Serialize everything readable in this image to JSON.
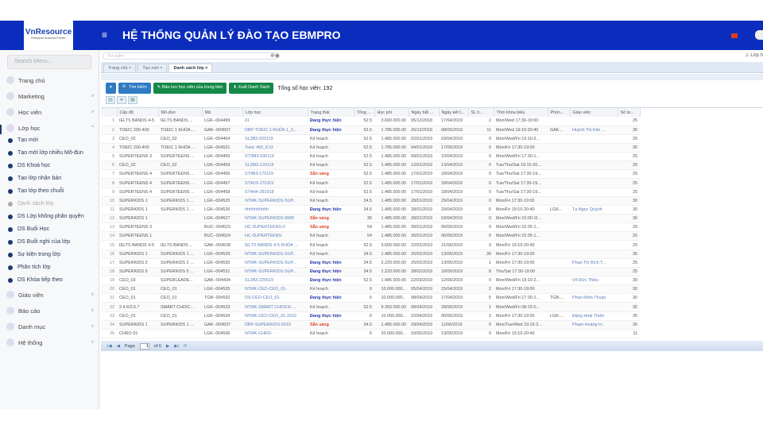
{
  "header": {
    "logo": "VnResource",
    "logo_tag": "Enterprise Business Partner",
    "title": "HỆ THỐNG QUẢN LÝ ĐÀO TẠO EBMPRO"
  },
  "sidebar": {
    "search_placeholder": "Search Menu...",
    "items": [
      {
        "label": "Trang chủ"
      },
      {
        "label": "Marketing"
      },
      {
        "label": "Học viên"
      },
      {
        "label": "Lớp học"
      }
    ],
    "sub": [
      "Tạo mới",
      "Tạo mới lớp nhiều Mô-đun",
      "DS Khoá học",
      "Tạo lớp nhân bản",
      "Tạo lớp theo chuỗi",
      "Danh sách lớp",
      "DS Lớp không phân quyền",
      "DS Buổi Học",
      "DS Buổi nghỉ của lớp",
      "Sự kiện trong lớp",
      "Phân tích lớp",
      "DS Khóa tiếp theo"
    ],
    "items2": [
      {
        "label": "Giáo viên"
      },
      {
        "label": "Báo cáo"
      },
      {
        "label": "Danh mục"
      },
      {
        "label": "Hệ thống"
      }
    ]
  },
  "search": {
    "placeholder": "Tìm kiếm"
  },
  "right_link": "Lớp h",
  "tabs": [
    "Trang chủ",
    "Tạo mới",
    "Danh sách lớp"
  ],
  "toolbar": {
    "search": "Tìm kiếm",
    "save": "Bảo lưu học viên của trung tâm",
    "export": "Xuất Danh Sách",
    "total": "Tổng số học viên: 192"
  },
  "colors": {
    "header": "#0b2dbd",
    "running": "#2a3aa8",
    "ready": "#e0452a",
    "plan": "#555555"
  },
  "columns": [
    "",
    "Cấp độ",
    "Mô-đun",
    "Mã",
    "Lớp học",
    "Trạng thái",
    "Tổng ...",
    "Học phí",
    "Ngày bắt ...",
    "Ngày kết t...",
    "SL h...",
    "Thời khóa biểu",
    "Phòn...",
    "Giáo viên",
    "Số lư..."
  ],
  "rows": [
    [
      "1",
      "IELTS BANDS 4-5",
      "IELTS BANDS ...",
      "LGK--004499",
      "01",
      "Đang thực hiện",
      "52.5",
      "3.600.000.00",
      "05/12/2018",
      "17/04/2019",
      "2",
      "Mon/Wed 17:30-19:00",
      "",
      "",
      "25"
    ],
    [
      "2",
      "TOEIC 200-400",
      "TOEIC 1 KHÓA ...",
      "GAK--004507",
      "DBP-TOEIC 1 KHÓA 1_3...",
      "Đang thực hiện",
      "52.5",
      "1.785.000.00",
      "26/12/2018",
      "08/05/2019",
      "11",
      "Mon/Wed 19:10-20:40",
      "GAK...",
      "Huỳnh Thị Kim ...",
      "30"
    ],
    [
      "3",
      "CEO_02",
      "CEO_02",
      "LGK--004454",
      "SL3B3-020119",
      "Kế hoạch",
      "52.5",
      "1.485.000.00",
      "02/01/2019",
      "03/04/2019",
      "0",
      "Mon/Wed/Fri 19:10-2...",
      "",
      "",
      "25"
    ],
    [
      "4",
      "TOEIC 200-400",
      "TOEIC 1 KHÓA ...",
      "LGK--004521",
      "Toeic 400_K13",
      "Kế hoạch",
      "52.5",
      "1.785.000.00",
      "04/01/2019",
      "17/05/2019",
      "0",
      "Mon/Fri 17:30-19:00",
      "",
      "",
      "30"
    ],
    [
      "5",
      "SUPERTEENS 3",
      "SUPERTEENS ...",
      "LGK--004455",
      "ST3M3-090119",
      "Kế hoạch",
      "52.5",
      "1.485.000.00",
      "09/01/2019",
      "10/04/2019",
      "0",
      "Mon/Wed/Fri 17:30-1...",
      "",
      "",
      "25"
    ],
    [
      "6",
      "CEO_02",
      "CEO_02",
      "LGK--004459",
      "SL3M3-120119",
      "Kế hoạch",
      "52.5",
      "1.485.000.00",
      "12/01/2019",
      "13/04/2019",
      "0",
      "Tue/Thu/Sat 19:10-20...",
      "",
      "",
      "25"
    ],
    [
      "7",
      "SUPERTEENS 4",
      "SUPERTEENS ...",
      "LGK--004456",
      "ST4B3-170119",
      "Sẵn sàng",
      "52.5",
      "1.485.000.00",
      "17/01/2019",
      "18/04/2019",
      "0",
      "Tue/Thu/Sat 17:30-19...",
      "",
      "",
      "25"
    ],
    [
      "8",
      "SUPERTEENS 4",
      "SUPERTEENS ...",
      "LGK--004457",
      "ST4D3-170119",
      "Kế hoạch",
      "52.5",
      "1.485.000.00",
      "17/01/2019",
      "18/04/2019",
      "0",
      "Tue/Thu/Sat 17:30-19...",
      "",
      "",
      "25"
    ],
    [
      "9",
      "SUPERTEENS 4",
      "SUPERTEENS ...",
      "LGK--004458",
      "ST4H4-281018",
      "Kế hoạch",
      "52.5",
      "1.485.000.00",
      "17/01/2019",
      "18/04/2019",
      "0",
      "Tue/Thu/Sat 17:30-19...",
      "",
      "",
      "25"
    ],
    [
      "10",
      "SUPERKIDS 1",
      "SUPERKIDS 1 ...",
      "LGK--004525",
      "NTMK-SUPERKIDS-SUP...",
      "Kế hoạch",
      "34.5",
      "1.485.000.00",
      "28/01/2019",
      "29/04/2019",
      "0",
      "Mon/Fri 17:30-19:00",
      "",
      "",
      "30"
    ],
    [
      "11",
      "SUPERKIDS 1",
      "SUPERKIDS 1 ...",
      "LGK--004526",
      "hhhhhhhhhh",
      "Đang thực hiện",
      "34.5",
      "1.485.000.00",
      "28/01/2019",
      "29/04/2019",
      "6",
      "Mon/Fri 19:10-20:40",
      "LGK...",
      "Tạ Ngọc Quỳnh",
      "30"
    ],
    [
      "12",
      "SUPERKIDS 1",
      "",
      "LGK--004527",
      "NTMK-SUPERKIDS-9999",
      "Sẵn sàng",
      "36",
      "1.485.000.00",
      "28/01/2019",
      "03/04/2019",
      "0",
      "Mon/Wed/Fri 10:00-11...",
      "",
      "",
      "30"
    ],
    [
      "13",
      "SUPERTEENS 3",
      "",
      "BUC--004523",
      "HC-SUPERTEENS-II",
      "Sẵn sàng",
      "54",
      "1.485.000.00",
      "30/01/2019",
      "06/05/2019",
      "0",
      "Mon/Wed/Fri 15:35-1...",
      "",
      "",
      "20"
    ],
    [
      "14",
      "SUPERTEENS 1",
      "",
      "BUC--004524",
      "HC-SUPERTEENS-",
      "Kế hoạch",
      "54",
      "1.485.000.00",
      "30/01/2019",
      "06/05/2019",
      "0",
      "Mon/Wed/Fri 15:35-1...",
      "",
      "",
      "20"
    ],
    [
      "15",
      "IELTS BANDS 4-5",
      "IELTS BANDS ...",
      "GAK--004528",
      "IELTS BANDS 4-5 KHÓA ...",
      "Kế hoạch",
      "52.5",
      "3.600.000.00",
      "22/02/2019",
      "21/06/2019",
      "0",
      "Mon/Fri 19:10-20:40",
      "",
      "",
      "25"
    ],
    [
      "16",
      "SUPERKIDS 1",
      "SUPERKIDS 1 ...",
      "LGK--004529",
      "NTMK-SUPERKIDS-SUP...",
      "Kế hoạch",
      "34.5",
      "1.485.000.00",
      "25/02/2019",
      "13/05/2019",
      "39",
      "Mon/Fri 17:30-19:00",
      "",
      "",
      "30"
    ],
    [
      "17",
      "SUPERKIDS 2",
      "SUPERKIDS 2 ...",
      "LGK--004530",
      "NTMK-SUPERKIDS-SUP...",
      "Đang thực hiện",
      "34.5",
      "2.220.000.00",
      "25/02/2019",
      "13/05/2019",
      "1",
      "Mon/Fri 17:30-19:00",
      "",
      "Phan Thị Bích T...",
      "25"
    ],
    [
      "18",
      "SUPERKIDS 5",
      "SUPERKIDS 5 ...",
      "LGK--004531",
      "NTMK-SUPERKIDS-SUP...",
      "Đang thực hiện",
      "34.5",
      "2.220.000.00",
      "28/02/2019",
      "18/05/2019",
      "8",
      "Thu/Sat 17:30-19:00",
      "",
      "",
      "25"
    ],
    [
      "19",
      "CEO_03",
      "SUPERLEADE...",
      "GAK--004434",
      "SL2B3-220519",
      "Đang thực hiện",
      "52.5",
      "1.485.000.00",
      "22/03/2019",
      "12/06/2019",
      "0",
      "Mon/Wed/Fri 19:10-2...",
      "",
      "Võ Đức Thiều",
      "30"
    ],
    [
      "20",
      "CEO_01",
      "CEO_01",
      "LGK--004535",
      "NTMK-CEO-CEO_01-",
      "Kế hoạch",
      "6",
      "10.000.000...",
      "05/04/2019",
      "15/04/2019",
      "2",
      "Mon/Fri 17:30-19:00",
      "",
      "",
      "30"
    ],
    [
      "21",
      "CEO_01",
      "CEO_01",
      "TGB--004532",
      "DS-CEO-CEO_01-",
      "Đang thực hiện",
      "6",
      "10.000.000...",
      "08/04/2019",
      "17/04/2019",
      "5",
      "Mon/Wed/Fri 17:30-1...",
      "TGB-...",
      "Phan Minh Thuận",
      "30"
    ],
    [
      "22",
      "2.4.6/3.5.7",
      "SMART CHOIC...",
      "LGK--004533",
      "NTMK-SMART CHOICE-...",
      "Kế hoạch",
      "52.5",
      "9.350.000.00",
      "08/04/2019",
      "28/06/2019",
      "1",
      "Mon/Wed/Fri 08:15-0...",
      "",
      "",
      "30"
    ],
    [
      "23",
      "CEO_01",
      "CEO_01",
      "LGK--004534",
      "NTMK-CEO-CEO_01-2019",
      "Đang thực hiện",
      "6",
      "10.000.000...",
      "22/04/2019",
      "06/05/2019",
      "2",
      "Mon/Fri 17:30-19:00",
      "LGK-...",
      "Đặng Hoài Thiện",
      "30"
    ],
    [
      "24",
      "SUPERKIDS 1",
      "SUPERKIDS 1 ...",
      "GAK--004537",
      "DBP-SUPERKIDS-0010",
      "Sẵn sàng",
      "34.5",
      "1.485.000.00",
      "29/04/2019",
      "11/06/2019",
      "0",
      "Mon/Tue/Wed 19:15-2...",
      "",
      "Phạm Hoàng H...",
      "30"
    ],
    [
      "25",
      "CHRO 01",
      "",
      "LGK--004536",
      "NTMK-CHRO-",
      "Kế hoạch",
      "6",
      "20.000.000...",
      "03/05/2019",
      "13/05/2019",
      "0",
      "Mon/Fri 19:10-20:40",
      "",
      "",
      "11"
    ]
  ],
  "pager": {
    "page_label": "Page",
    "page": "1",
    "of": "of 6"
  }
}
